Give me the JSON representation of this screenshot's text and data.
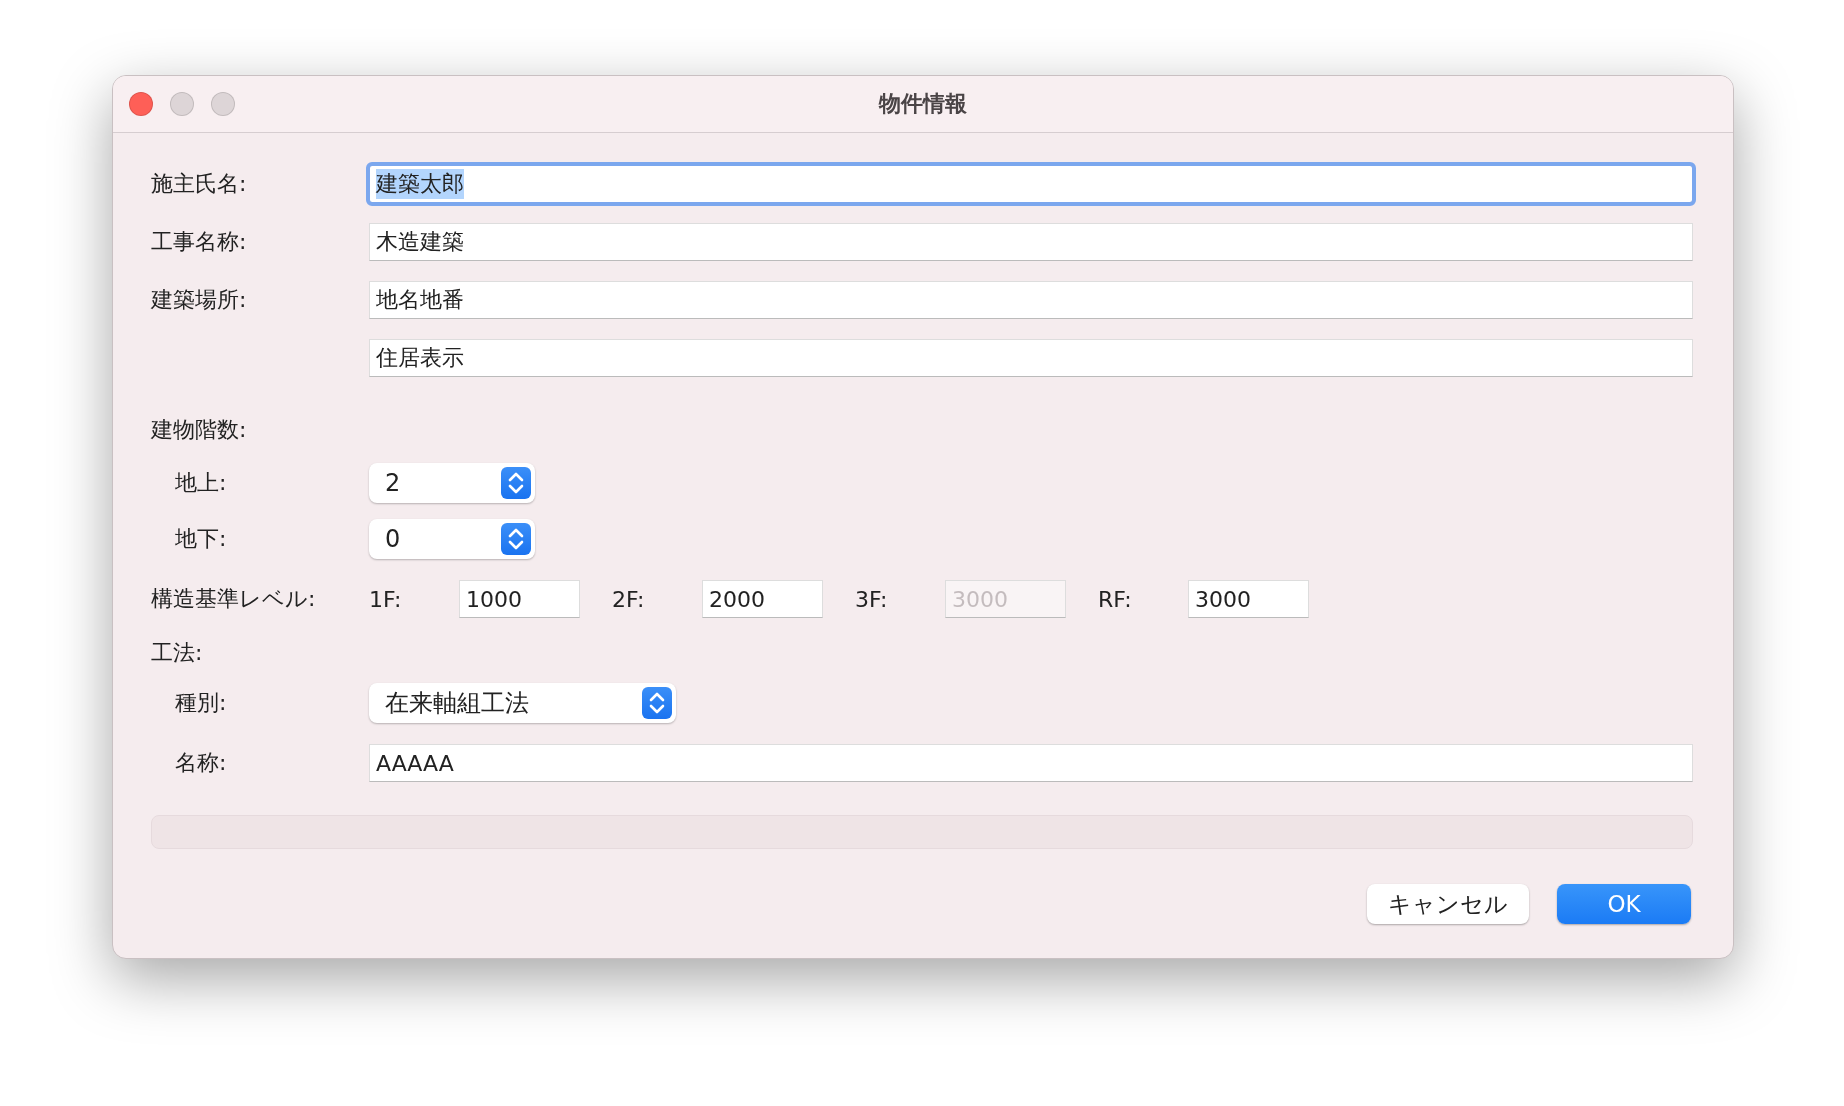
{
  "window": {
    "title": "物件情報"
  },
  "window_buttons": [
    {
      "kind": "close",
      "enabled": true
    },
    {
      "kind": "minimize",
      "enabled": false
    },
    {
      "kind": "zoom",
      "enabled": false
    }
  ],
  "text_fields": [
    {
      "label": "施主氏名:",
      "value": "建築太郎",
      "focused": true
    },
    {
      "label": "工事名称:",
      "value": "木造建築",
      "focused": false
    },
    {
      "label": "建築場所:",
      "value": "地名地番",
      "focused": false
    },
    {
      "value": "住居表示",
      "focused": false
    }
  ],
  "floors": {
    "label": "建物階数:",
    "steppers": [
      {
        "label": "地上:",
        "value": "2"
      },
      {
        "label": "地下:",
        "value": "0"
      }
    ]
  },
  "levels": {
    "label": "構造基準レベル:",
    "fields": [
      {
        "label": "1F:",
        "value": "1000",
        "disabled": false
      },
      {
        "label": "2F:",
        "value": "2000",
        "disabled": false
      },
      {
        "label": "3F:",
        "value": "3000",
        "disabled": true
      },
      {
        "label": "RF:",
        "value": "3000",
        "disabled": false
      }
    ]
  },
  "method": {
    "label": "工法:",
    "type": {
      "label": "種別:",
      "value": "在来軸組工法"
    },
    "name": {
      "label": "名称:",
      "value": "AAAAA"
    }
  },
  "buttons": [
    {
      "label": "キャンセル",
      "default": false
    },
    {
      "label": "OK",
      "default": true
    }
  ]
}
